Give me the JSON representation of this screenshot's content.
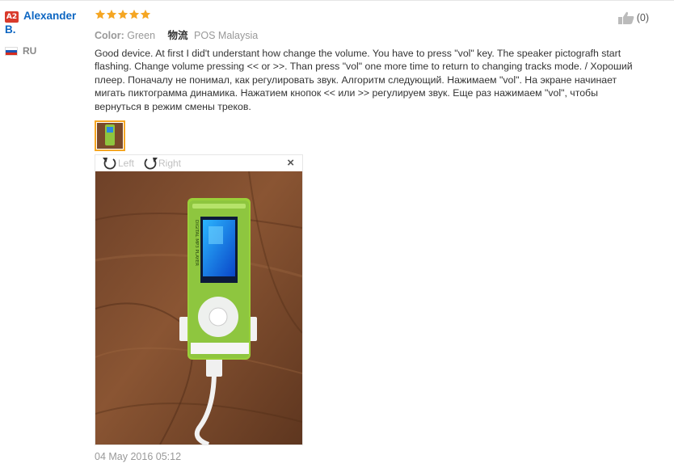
{
  "user": {
    "level": "A2",
    "name_line1": "Alexander",
    "name_line2": "B.",
    "country": "RU",
    "flag_colors": [
      "#ffffff",
      "#1c55b4",
      "#d52b1e"
    ]
  },
  "review": {
    "rating": 5,
    "star_color": "#f5a623",
    "color_label": "Color:",
    "color_value": "Green",
    "shipping_icon": "物流",
    "shipping_value": "POS Malaysia",
    "text": "Good device. At first I did't understant how change the volume. You have to press \"vol\" key. The speaker pictografh start flashing. Change volume pressing << or >>. Than press \"vol\" one more time to return to changing tracks mode. / Хороший плеер. Поначалу не понимал, как регулировать звук. Алгоритм следующий. Нажимаем \"vol\". На экране начинает мигать пиктограмма динамика. Нажатием кнопок << или >> регулируем звук. Еще раз нажимаем \"vol\", чтобы вернуться в режим смены треков.",
    "date": "04 May 2016 05:12",
    "helpful_count": "(0)"
  },
  "viewer": {
    "rotate_left_label": "Left",
    "rotate_right_label": "Right",
    "close_symbol": "×",
    "device_label": "DIGITAL MP3 PLAYER"
  }
}
